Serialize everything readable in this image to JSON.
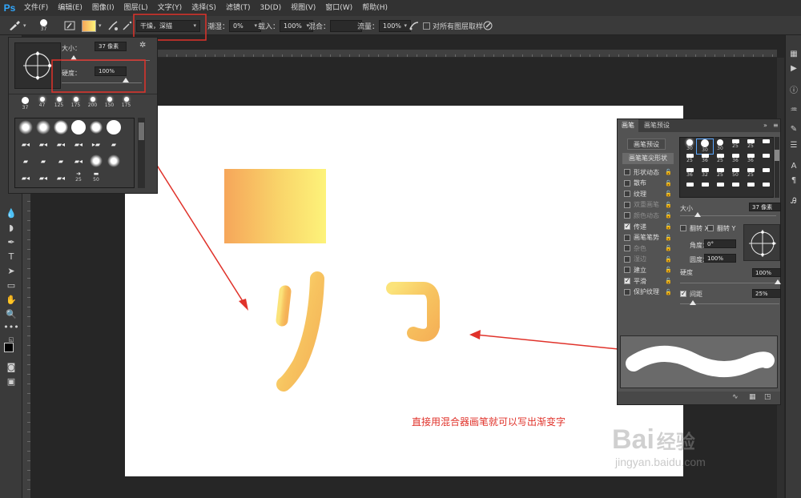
{
  "app": {
    "logo": "Ps"
  },
  "menu": [
    "文件(F)",
    "编辑(E)",
    "图像(I)",
    "图层(L)",
    "文字(Y)",
    "选择(S)",
    "滤镜(T)",
    "3D(D)",
    "视图(V)",
    "窗口(W)",
    "帮助(H)"
  ],
  "options": {
    "brush_size_value": "37",
    "blend_preset": "干燥，深描",
    "wet_label": "潮湿：",
    "wet_value": "0%",
    "load_label": "载入：",
    "load_value": "100%",
    "mix_label": "混合：",
    "mix_value": "",
    "flow_label": "流量：",
    "flow_value": "100%",
    "sample_all_layers": "对所有图层取样"
  },
  "picker": {
    "size_label": "大小：",
    "size_value": "37 像素",
    "hardness_label": "硬度：",
    "hardness_value": "100%",
    "thumbs": [
      {
        "label": "37",
        "d": 8
      },
      {
        "label": "47",
        "d": 7
      },
      {
        "label": "125",
        "d": 7
      },
      {
        "label": "175",
        "d": 7
      },
      {
        "label": "200",
        "d": 7
      },
      {
        "label": "150",
        "d": 7
      },
      {
        "label": "175",
        "d": 7
      }
    ],
    "grid_labels": [
      "25",
      "50"
    ]
  },
  "brush_panel": {
    "tab_brush": "画笔",
    "tab_presets": "画笔预设",
    "preset_button": "画笔预设",
    "tip_shape": "画笔笔尖形状",
    "items": [
      {
        "label": "形状动态",
        "on": false,
        "dim": false
      },
      {
        "label": "散布",
        "on": false,
        "dim": false
      },
      {
        "label": "纹理",
        "on": false,
        "dim": false
      },
      {
        "label": "双重画笔",
        "on": false,
        "dim": true
      },
      {
        "label": "颜色动态",
        "on": false,
        "dim": true
      },
      {
        "label": "传递",
        "on": true,
        "dim": false
      },
      {
        "label": "画笔笔势",
        "on": false,
        "dim": false
      },
      {
        "label": "杂色",
        "on": false,
        "dim": true
      },
      {
        "label": "湿边",
        "on": false,
        "dim": true
      },
      {
        "label": "建立",
        "on": false,
        "dim": false
      },
      {
        "label": "平滑",
        "on": true,
        "dim": false
      },
      {
        "label": "保护纹理",
        "on": false,
        "dim": false
      }
    ],
    "grid": [
      "30",
      "30",
      "30",
      "25",
      "25",
      "25",
      "36",
      "25",
      "36",
      "36",
      "36",
      "32",
      "25",
      "50",
      "25"
    ],
    "size_label": "大小",
    "size_value": "37 像素",
    "flip_x": "翻转 X",
    "flip_y": "翻转 Y",
    "angle_label": "角度：",
    "angle_value": "0°",
    "roundness_label": "圆度：",
    "roundness_value": "100%",
    "hardness_label": "硬度",
    "hardness_value": "100%",
    "spacing_label": "间距",
    "spacing_value": "25%"
  },
  "canvas": {
    "annotation": "直接用混合器画笔就可以写出渐变字",
    "watermark_main": "Bai",
    "watermark_cn": "经验",
    "watermark_url": "jingyan.baidu.com"
  },
  "colors": {
    "accent": "#31a8ff",
    "annotation": "#e0322a",
    "gradient_start": "#f6a65a",
    "gradient_end": "#fdf37a"
  }
}
